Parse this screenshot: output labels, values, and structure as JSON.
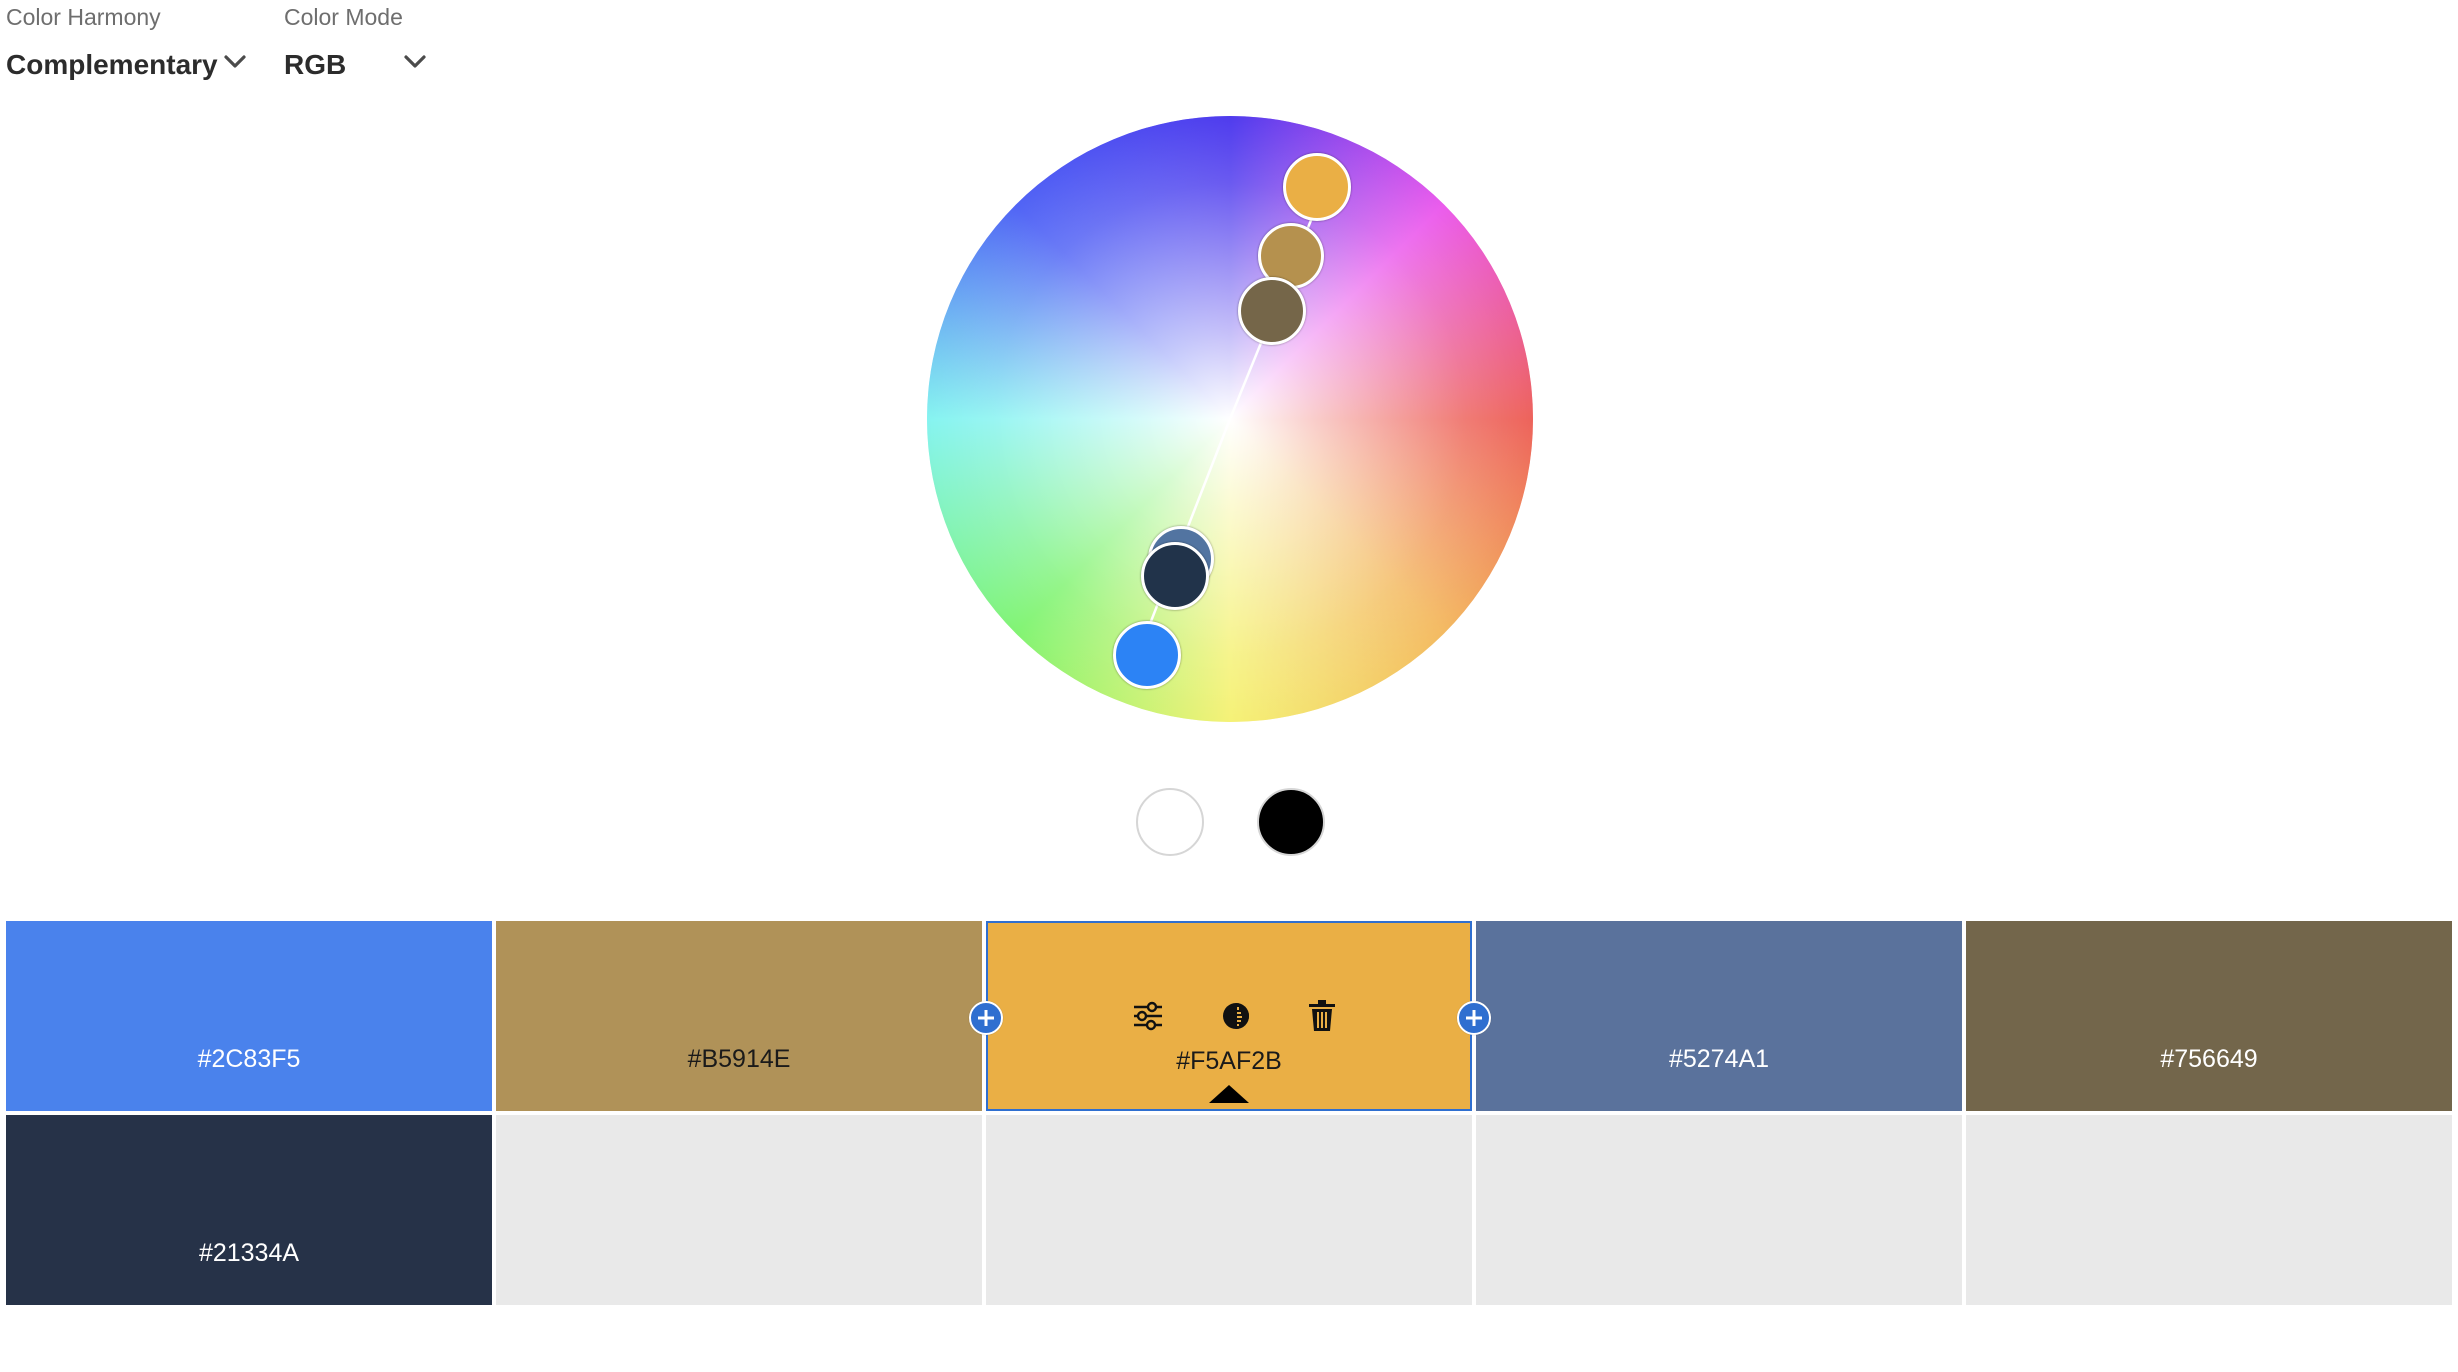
{
  "controls": {
    "harmony": {
      "label": "Color Harmony",
      "value": "Complementary",
      "icon": "chevron-down-icon"
    },
    "mode": {
      "label": "Color Mode",
      "value": "RGB",
      "icon": "chevron-down-icon"
    }
  },
  "wheel": {
    "handles": [
      {
        "color": "#EAAF45",
        "role": "base"
      },
      {
        "color": "#B5914E"
      },
      {
        "color": "#756649"
      },
      {
        "color": "#5274A1"
      },
      {
        "color": "#21334A"
      },
      {
        "color": "#2C83F5"
      }
    ]
  },
  "brightness_swatches": {
    "white": "#FFFFFF",
    "black": "#000000"
  },
  "swatches": {
    "row1": [
      {
        "hex": "#2C83F5",
        "color": "#4a82ec",
        "selected": false
      },
      {
        "hex": "#B5914E",
        "color": "#b09258",
        "selected": false
      },
      {
        "hex": "#F5AF2B",
        "color": "#eaaf45",
        "selected": true
      },
      {
        "hex": "#5274A1",
        "color": "#5a729c",
        "selected": false
      },
      {
        "hex": "#756649",
        "color": "#73664b",
        "selected": false
      }
    ],
    "row2": [
      {
        "hex": "#21334A",
        "color": "#263248"
      }
    ],
    "tools": {
      "adjust_icon": "sliders-icon",
      "contrast_icon": "contrast-icon",
      "delete_icon": "trash-icon",
      "add_icon": "plus-icon"
    }
  },
  "accent": "#2F6FD0"
}
